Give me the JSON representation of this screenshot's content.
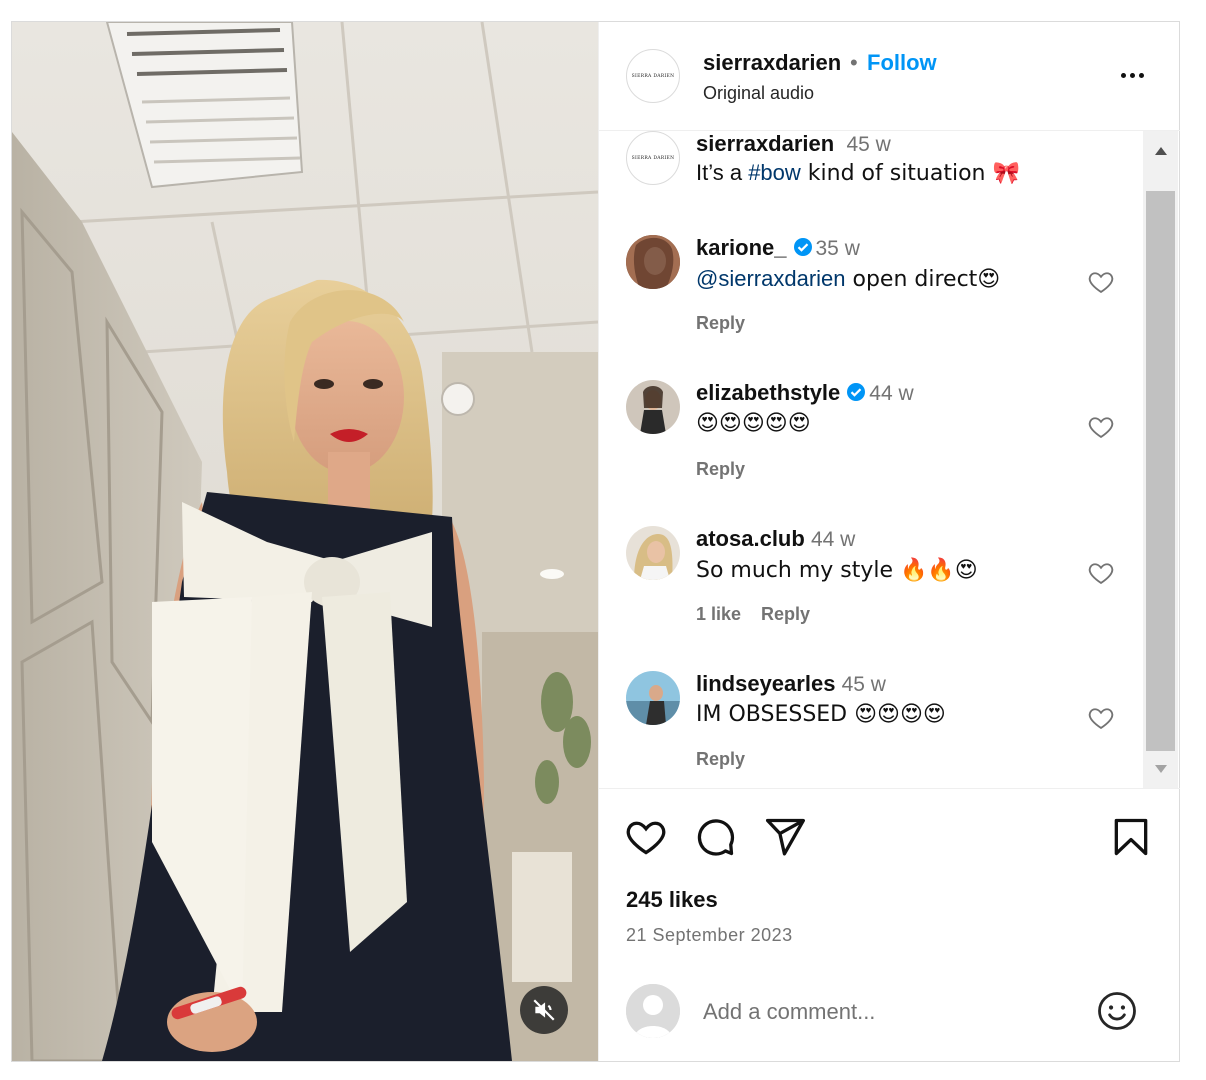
{
  "post": {
    "username": "sierraxdarien",
    "dot": "•",
    "follow_label": "Follow",
    "audio": "Original audio",
    "logo_text": "SIERRA DARIEN"
  },
  "comments": [
    {
      "user": "sierraxdarien",
      "verified": false,
      "time": "45 w",
      "text_parts": [
        "It’s a ",
        "#bow",
        " kind of situation 🎀"
      ],
      "meta": []
    },
    {
      "user": "karione_",
      "verified": true,
      "time": "35 w",
      "text_parts": [
        "@sierraxdarien",
        " open direct😍"
      ],
      "meta": [
        "Reply"
      ]
    },
    {
      "user": "elizabethstyle",
      "verified": true,
      "time": "44 w",
      "text_parts": [
        "😍😍😍😍😍"
      ],
      "meta": [
        "Reply"
      ]
    },
    {
      "user": "atosa.club",
      "verified": false,
      "time": "44 w",
      "text_parts": [
        "So much my style 🔥🔥😍"
      ],
      "meta": [
        "1 like",
        "Reply"
      ]
    },
    {
      "user": "lindseyearles",
      "verified": false,
      "time": "45 w",
      "text_parts": [
        "IM OBSESSED 😍😍😍😍"
      ],
      "meta": [
        "Reply"
      ]
    }
  ],
  "likes": "245 likes",
  "date": "21 September 2023",
  "add_comment": {
    "placeholder": "Add a comment..."
  },
  "icons": {
    "like": "heart-icon",
    "comment": "comment-icon",
    "share": "paper-plane-icon",
    "save": "bookmark-icon",
    "mute": "speaker-muted-icon",
    "more": "more-dots-icon",
    "emoji": "smiley-icon"
  },
  "colors": {
    "accent": "#0095f6",
    "link": "#00376b",
    "muted": "#737373"
  }
}
